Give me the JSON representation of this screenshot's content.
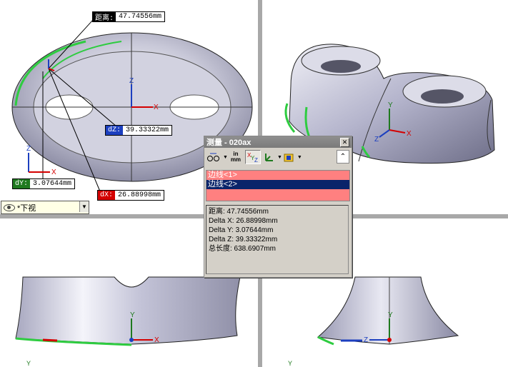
{
  "views": {
    "top_left": {
      "label_distance": {
        "key": "距离:",
        "value": "47.74556mm"
      },
      "label_dz": {
        "key": "dZ:",
        "value": "39.33322mm"
      },
      "label_dy": {
        "key": "dY:",
        "value": "3.07644mm"
      },
      "label_dx": {
        "key": "dX:",
        "value": "26.88998mm"
      },
      "view_selector": "*下视"
    },
    "axis_letters": {
      "x": "X",
      "y": "Y",
      "z": "Z"
    }
  },
  "dialog": {
    "title": "测量 - 020ax",
    "units_label_top": "in",
    "units_label_bottom": "mm",
    "selections": [
      "边线<1>",
      "边线<2>",
      ""
    ],
    "results": [
      "距离: 47.74556mm",
      "Delta X: 26.88998mm",
      "Delta Y: 3.07644mm",
      "Delta Z: 39.33322mm",
      "总长度: 638.6907mm"
    ]
  },
  "colors": {
    "tag_dark": "#000000",
    "tag_dz": "#1c3fbf",
    "tag_dy": "#1f7a1f",
    "tag_dx": "#d40000",
    "highlight_green": "#2ecc40",
    "selection_pink": "#ff8080",
    "selection_navy": "#0a246a"
  }
}
